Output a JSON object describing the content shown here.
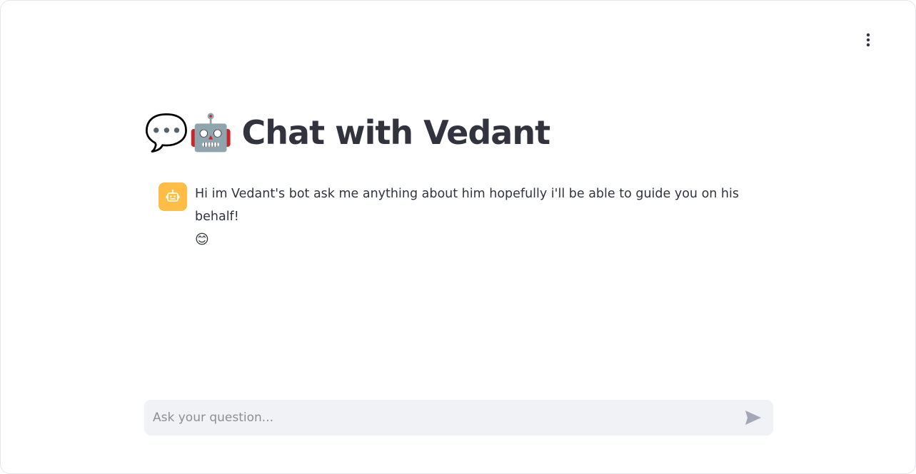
{
  "header": {
    "menu_icon": "vertical-ellipsis-icon"
  },
  "title": {
    "emoji_1": "💬",
    "emoji_1_icon": "speech-bubble-icon",
    "emoji_2": "🤖",
    "emoji_2_icon": "robot-face-icon",
    "text": "Chat with Vedant"
  },
  "messages": [
    {
      "role": "assistant",
      "avatar_icon": "bot-avatar-icon",
      "avatar_color": "#ffbd45",
      "text": "Hi im Vedant's bot ask me anything about him hopefully i'll be able to guide you on his behalf!",
      "emoji": "😊"
    }
  ],
  "chat_input": {
    "value": "",
    "placeholder": "Ask your question...",
    "send_icon": "send-arrow-icon"
  },
  "colors": {
    "text": "#31333f",
    "input_background": "#f0f2f6",
    "placeholder": "#8c8e96",
    "avatar": "#ffbd45",
    "send_icon": "#a3a8b8"
  }
}
